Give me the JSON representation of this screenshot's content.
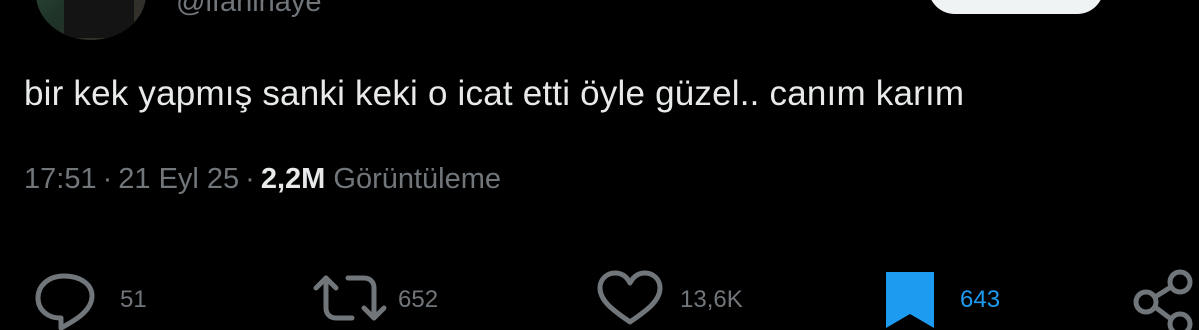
{
  "author": {
    "handle": "@lfaninaye"
  },
  "tweet": {
    "text": "bir kek yapmış sanki keki o icat etti öyle güzel.. canım karım",
    "time": "17:51",
    "separator": "·",
    "date": "21 Eyl 25",
    "views_count": "2,2M",
    "views_label": "Görüntüleme"
  },
  "actions": {
    "reply": {
      "icon": "reply-icon",
      "count": "51"
    },
    "repost": {
      "icon": "repost-icon",
      "count": "652"
    },
    "like": {
      "icon": "heart-icon",
      "count": "13,6K"
    },
    "bookmark": {
      "icon": "bookmark-icon",
      "count": "643",
      "active": true
    },
    "share": {
      "icon": "share-icon"
    }
  },
  "colors": {
    "background": "#000000",
    "text": "#e7e9ea",
    "muted": "#71767b",
    "accent": "#1d9bf0"
  }
}
